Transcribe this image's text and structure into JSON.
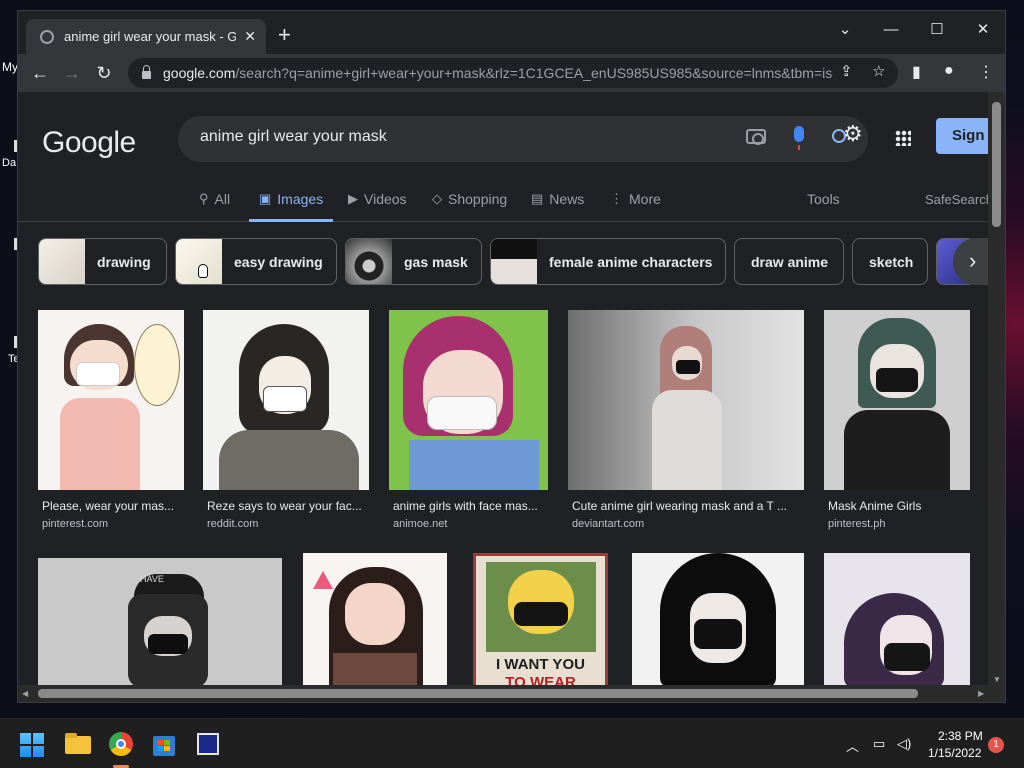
{
  "desktop": {
    "icon_labels": [
      "My",
      "Da",
      "Te"
    ]
  },
  "browser": {
    "tab_title": "anime girl wear your mask - Google Search",
    "new_tab": "+",
    "controls": {
      "dropdown": "⌄",
      "minimize": "—",
      "maximize": "☐",
      "close": "✕"
    },
    "url_host": "google.com",
    "url_rest": "/search?q=anime+girl+wear+your+mask&rlz=1C1GCEA_enUS985US985&source=lnms&tbm=isch"
  },
  "google": {
    "logo": "Google",
    "query": "anime girl wear your mask",
    "sign_in": "Sign in",
    "tabs": [
      {
        "icon": "⚲",
        "label": "All"
      },
      {
        "icon": "▣",
        "label": "Images"
      },
      {
        "icon": "▶",
        "label": "Videos"
      },
      {
        "icon": "◇",
        "label": "Shopping"
      },
      {
        "icon": "▤",
        "label": "News"
      },
      {
        "icon": "⋮",
        "label": "More"
      }
    ],
    "tools": "Tools",
    "safesearch": "SafeSearch",
    "chips": [
      "drawing",
      "easy drawing",
      "gas mask",
      "female anime characters",
      "draw anime",
      "sketch"
    ],
    "results": [
      {
        "title": "Please, wear your mas...",
        "source": "pinterest.com"
      },
      {
        "title": "Reze says to wear your fac...",
        "source": "reddit.com"
      },
      {
        "title": "anime girls with face mas...",
        "source": "animoe.net"
      },
      {
        "title": "Cute anime girl wearing mask and a T ...",
        "source": "deviantart.com"
      },
      {
        "title": "Mask Anime Girls",
        "source": "pinterest.ph"
      }
    ],
    "poster_text": [
      "I WANT YOU",
      "TO WEAR"
    ],
    "cap_text": "HAVE"
  },
  "taskbar": {
    "time": "2:38 PM",
    "date": "1/15/2022",
    "notifications": "1"
  }
}
